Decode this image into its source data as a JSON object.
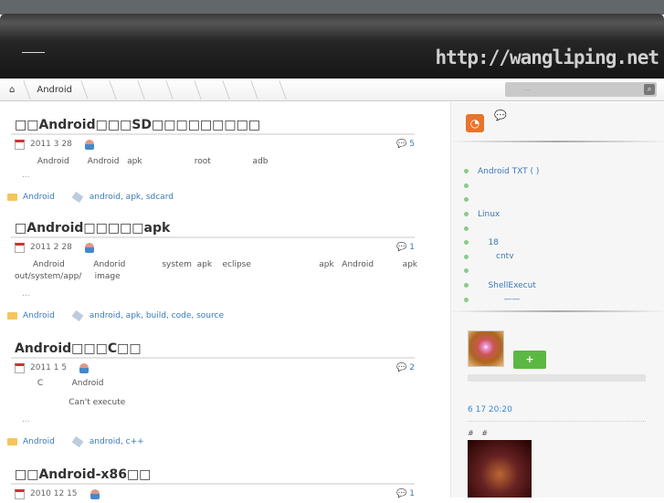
{
  "header": {
    "site_url": "http://wangliping.net"
  },
  "breadcrumb": {
    "home": "home",
    "current": "Android"
  },
  "search": {
    "placeholder": "..."
  },
  "posts": [
    {
      "title": "□□Android□□□SD□□□□□□□□□",
      "date": "2011 3 28",
      "comments": "5",
      "excerpt": "        Android       Android   apk                    root                adb",
      "more": "...",
      "category": "Android",
      "tags": "android, apk, sdcard"
    },
    {
      "title": "□Android□□□□□apk",
      "date": "2011 2 28",
      "comments": "1",
      "excerpt": "       Android           Andorid              system  apk    eclipse                          apk   Android           apk\nout/system/app/     image",
      "more": "...",
      "category": "Android",
      "tags": "android, apk, build, code, source"
    },
    {
      "title": "Android□□□C□□",
      "date": "2011 1 5",
      "comments": "2",
      "excerpt": "        C           Android\n\n                    Can't execute",
      "more": "...",
      "category": "Android",
      "tags": "android, c++"
    },
    {
      "title": "□□Android-x86□□",
      "date": "2010 12 15",
      "comments": "1"
    }
  ],
  "sidebar": {
    "recent": [
      "Android TXT     ( )",
      "",
      "",
      "Linux",
      "",
      "    18",
      "       cntv",
      "",
      "    ShellExecut",
      "          ——"
    ],
    "follow_label": "+",
    "weibo_time": "6 17  20:20",
    "hashtags": "# #"
  }
}
